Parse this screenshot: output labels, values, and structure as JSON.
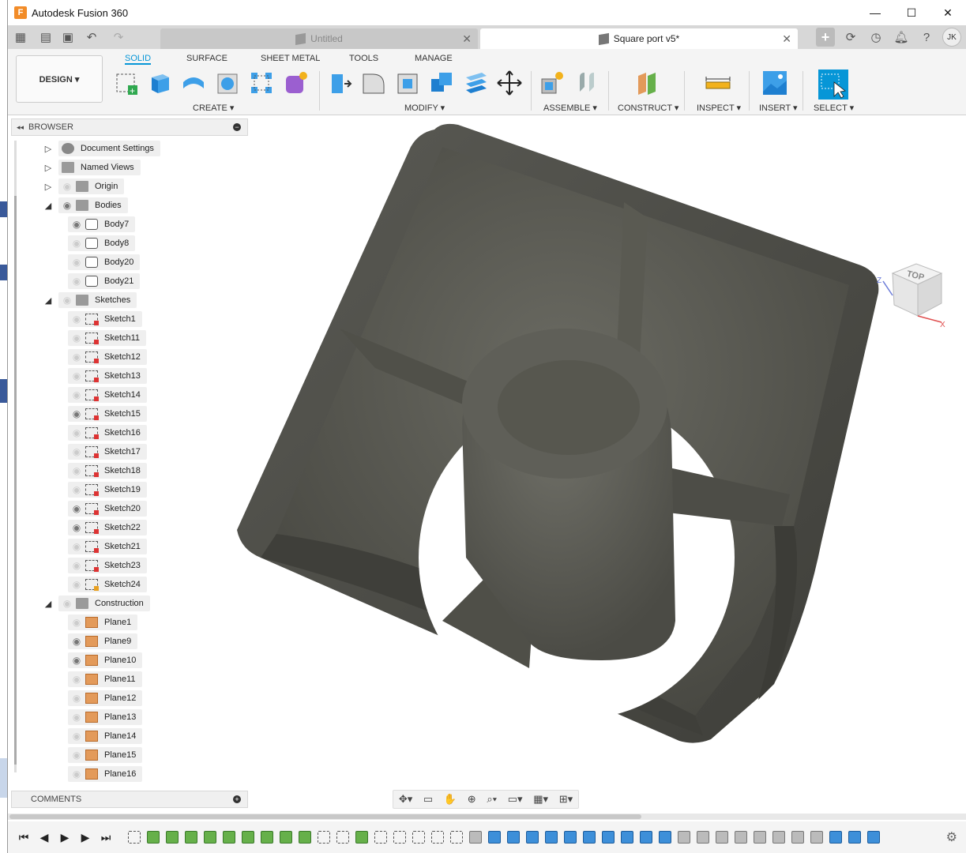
{
  "window": {
    "app_title": "Autodesk Fusion 360",
    "logo_letter": "F",
    "minimize": "—",
    "maximize": "☐",
    "close": "✕"
  },
  "tabs": {
    "inactive_label": "Untitled",
    "active_label": "Square port v5*",
    "close_glyph": "✕",
    "user_initials": "JK"
  },
  "ribbon": {
    "workspace": "DESIGN ▾",
    "tabs": [
      "SOLID",
      "SURFACE",
      "SHEET METAL",
      "TOOLS",
      "MANAGE"
    ],
    "active_tab": "SOLID",
    "groups": {
      "create": "CREATE ▾",
      "modify": "MODIFY ▾",
      "assemble": "ASSEMBLE ▾",
      "construct": "CONSTRUCT ▾",
      "inspect": "INSPECT ▾",
      "insert": "INSERT ▾",
      "select": "SELECT ▾"
    }
  },
  "browser": {
    "title": "BROWSER",
    "nodes": [
      {
        "label": "Document Settings",
        "icon": "gear-icon",
        "arrow": "▷"
      },
      {
        "label": "Named Views",
        "icon": "folder-icon",
        "arrow": "▷"
      },
      {
        "label": "Origin",
        "icon": "folder-icon",
        "arrow": "▷"
      },
      {
        "label": "Bodies",
        "icon": "folder-icon",
        "arrow": "◢"
      },
      {
        "label": "Body7",
        "icon": "body-icon"
      },
      {
        "label": "Body8",
        "icon": "body-icon"
      },
      {
        "label": "Body20",
        "icon": "body-icon"
      },
      {
        "label": "Body21",
        "icon": "body-icon"
      },
      {
        "label": "Sketches",
        "icon": "folder-icon",
        "arrow": "◢"
      },
      {
        "label": "Sketch1",
        "icon": "sketch-icon"
      },
      {
        "label": "Sketch11",
        "icon": "sketch-icon"
      },
      {
        "label": "Sketch12",
        "icon": "sketch-icon"
      },
      {
        "label": "Sketch13",
        "icon": "sketch-icon"
      },
      {
        "label": "Sketch14",
        "icon": "sketch-icon"
      },
      {
        "label": "Sketch15",
        "icon": "sketch-icon"
      },
      {
        "label": "Sketch16",
        "icon": "sketch-icon"
      },
      {
        "label": "Sketch17",
        "icon": "sketch-icon"
      },
      {
        "label": "Sketch18",
        "icon": "sketch-icon"
      },
      {
        "label": "Sketch19",
        "icon": "sketch-icon"
      },
      {
        "label": "Sketch20",
        "icon": "sketch-icon"
      },
      {
        "label": "Sketch22",
        "icon": "sketch-icon"
      },
      {
        "label": "Sketch21",
        "icon": "sketch-icon"
      },
      {
        "label": "Sketch23",
        "icon": "sketch-icon"
      },
      {
        "label": "Sketch24",
        "icon": "sketch-edit-icon"
      },
      {
        "label": "Construction",
        "icon": "folder-icon",
        "arrow": "◢"
      },
      {
        "label": "Plane1",
        "icon": "plane-icon"
      },
      {
        "label": "Plane9",
        "icon": "plane-icon"
      },
      {
        "label": "Plane10",
        "icon": "plane-icon"
      },
      {
        "label": "Plane11",
        "icon": "plane-icon"
      },
      {
        "label": "Plane12",
        "icon": "plane-icon"
      },
      {
        "label": "Plane13",
        "icon": "plane-icon"
      },
      {
        "label": "Plane14",
        "icon": "plane-icon"
      },
      {
        "label": "Plane15",
        "icon": "plane-icon"
      },
      {
        "label": "Plane16",
        "icon": "plane-icon"
      }
    ]
  },
  "comments": {
    "title": "COMMENTS"
  },
  "viewcube": {
    "face_label": "TOP",
    "axis_x": "X",
    "axis_z": "Z"
  }
}
